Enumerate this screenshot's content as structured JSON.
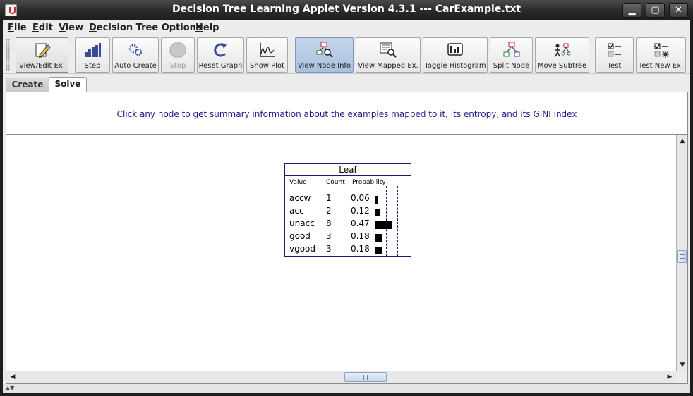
{
  "window": {
    "title": "Decision Tree Learning Applet Version 4.3.1 --- CarExample.txt",
    "minimize_glyph": "▁",
    "maximize_glyph": "▢",
    "close_glyph": "✕"
  },
  "menubar": {
    "items": [
      {
        "mnemonic": "F",
        "rest": "ile"
      },
      {
        "mnemonic": "E",
        "rest": "dit"
      },
      {
        "mnemonic": "V",
        "rest": "iew"
      },
      {
        "mnemonic": "D",
        "rest": "ecision Tree Options"
      },
      {
        "mnemonic": "H",
        "rest": "elp"
      }
    ]
  },
  "toolbar": {
    "buttons": [
      {
        "label": "View/Edit Ex.",
        "icon": "pencil-icon"
      },
      {
        "label": "Step",
        "icon": "step-bars-icon"
      },
      {
        "label": "Auto Create",
        "icon": "gears-icon"
      },
      {
        "label": "Stop",
        "icon": "stop-icon"
      },
      {
        "label": "Reset Graph",
        "icon": "reset-icon"
      },
      {
        "label": "Show Plot",
        "icon": "plot-icon"
      },
      {
        "label": "View Node Info",
        "icon": "node-info-icon"
      },
      {
        "label": "View Mapped Ex.",
        "icon": "mapped-examples-icon"
      },
      {
        "label": "Toggle Histogram",
        "icon": "histogram-icon"
      },
      {
        "label": "Split Node",
        "icon": "split-node-icon"
      },
      {
        "label": "Move Subtree",
        "icon": "move-subtree-icon"
      },
      {
        "label": "Test",
        "icon": "test-icon"
      },
      {
        "label": "Test New Ex.",
        "icon": "test-new-icon"
      }
    ],
    "active": "View Node Info",
    "disabled": "Stop"
  },
  "tabs": [
    {
      "label": "Create"
    },
    {
      "label": "Solve"
    }
  ],
  "selected_tab": "Solve",
  "info": {
    "message": "Click any node to get summary information about the examples mapped to it, its entropy, and its GINI index"
  },
  "leaf_node": {
    "title": "Leaf",
    "headers": {
      "value": "Value",
      "count": "Count",
      "probability": "Probability"
    },
    "rows": [
      {
        "value": "accw",
        "count": "1",
        "probability": "0.06",
        "p": 0.06
      },
      {
        "value": "acc",
        "count": "2",
        "probability": "0.12",
        "p": 0.12
      },
      {
        "value": "unacc",
        "count": "8",
        "probability": "0.47",
        "p": 0.47
      },
      {
        "value": "good",
        "count": "3",
        "probability": "0.18",
        "p": 0.18
      },
      {
        "value": "vgood",
        "count": "3",
        "probability": "0.18",
        "p": 0.18
      }
    ]
  },
  "scroll": {
    "up_glyph": "▲",
    "down_glyph": "▼",
    "left_glyph": "◀",
    "right_glyph": "▶"
  },
  "colors": {
    "accent_text": "#1a1a8c",
    "active_button": "#b8cbe4"
  }
}
